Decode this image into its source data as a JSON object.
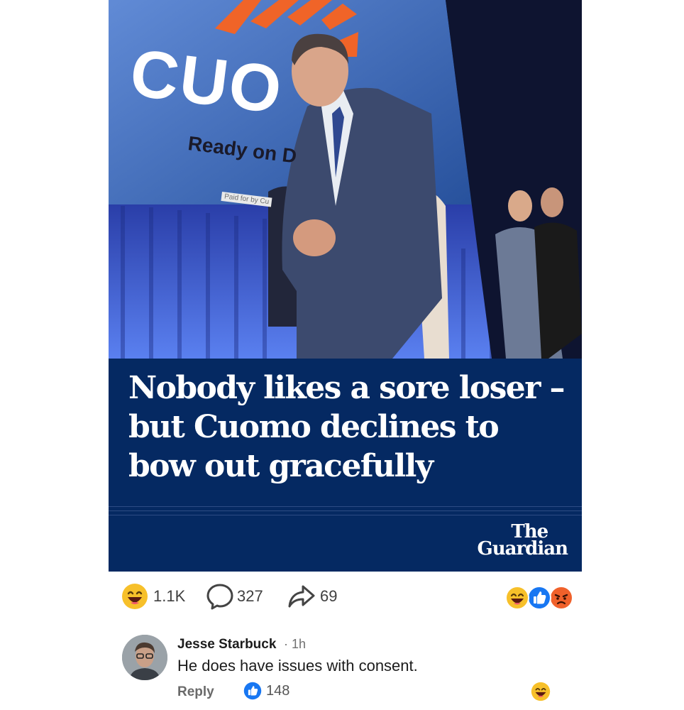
{
  "post": {
    "sign": {
      "brand": "CUO",
      "tagline": "Ready on D",
      "paid_note": "Paid for by Cu"
    },
    "headline": "Nobody likes a sore loser – but Cuomo declines to bow out gracefully",
    "publisher": {
      "line1": "The",
      "line2": "Guardian"
    }
  },
  "actions": {
    "reactions_icon": "laughing-emoji-icon",
    "reactions_count": "1.1K",
    "comments_icon": "comment-bubble-icon",
    "comments_count": "327",
    "shares_icon": "share-arrow-icon",
    "shares_count": "69",
    "reaction_summary": [
      "laughing-emoji-icon",
      "thumbs-up-icon",
      "angry-emoji-icon"
    ]
  },
  "comment": {
    "author": "Jesse Starbuck",
    "time": "· 1h",
    "text": "He does have issues with consent.",
    "reply_label": "Reply",
    "like_count": "148",
    "reaction_icon": "laughing-emoji-icon"
  },
  "colors": {
    "guardian_navy": "#052962",
    "facebook_blue": "#1877f2",
    "emoji_yellow": "#f7c02a",
    "angry_orange": "#f0612b"
  }
}
